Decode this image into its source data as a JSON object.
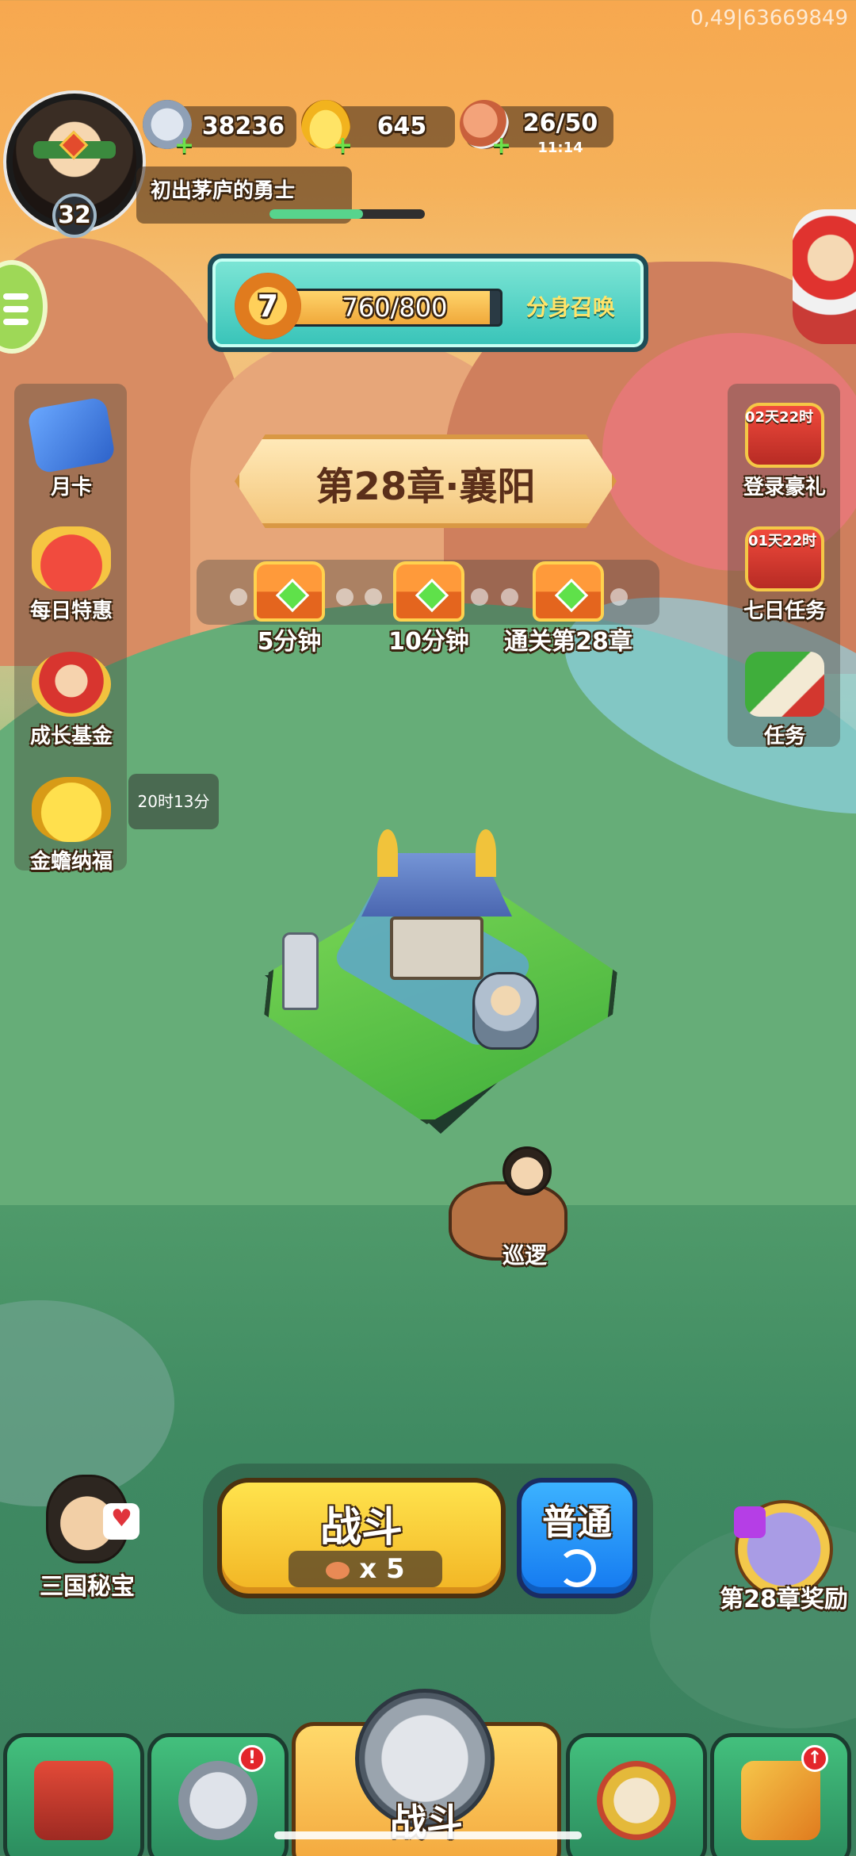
{
  "debug_text": "0,49|63669849",
  "player": {
    "level": "32",
    "title": "初出茅庐的勇士",
    "xp_progress_percent": 60
  },
  "resources": {
    "silver": {
      "value": "38236",
      "icon": "coin-icon"
    },
    "gold": {
      "value": "645",
      "icon": "gold-ingot-icon"
    },
    "stamina": {
      "value": "26/50",
      "timer": "11:14",
      "icon": "meat-icon"
    }
  },
  "summon": {
    "level": "7",
    "progress_text": "760/800",
    "progress_fraction": 0.95,
    "label": "分身召唤"
  },
  "left_menu": [
    {
      "label": "月卡",
      "icon": "monthly-card-icon"
    },
    {
      "label": "每日特惠",
      "icon": "gift-bag-icon"
    },
    {
      "label": "成长基金",
      "icon": "growth-fund-icon"
    },
    {
      "label": "金蟾纳福",
      "icon": "golden-toad-icon"
    }
  ],
  "golden_toad_timer": "20时13分",
  "right_menu": [
    {
      "label": "登录豪礼",
      "timer": "02天22时",
      "icon": "login-gift-icon"
    },
    {
      "label": "七日任务",
      "timer": "01天22时",
      "icon": "seven-day-task-icon"
    },
    {
      "label": "任务",
      "icon": "task-book-icon"
    }
  ],
  "chapter": {
    "title": "第28章·襄阳"
  },
  "chests": [
    {
      "label": "5分钟"
    },
    {
      "label": "10分钟"
    },
    {
      "label": "通关第28章"
    }
  ],
  "patrol_label": "巡逻",
  "battle": {
    "label": "战斗",
    "cost": "x 5",
    "mode_label": "普通"
  },
  "treasure_label": "三国秘宝",
  "chapter_reward_label": "第28章奖励",
  "nav": {
    "center_label": "战斗"
  },
  "colors": {
    "sky_top": "#f7a84f",
    "grass": "#4f9a6a",
    "battle_button": "#ffe34d",
    "normal_button": "#1479f0",
    "summon_banner": "#37c3b8"
  }
}
